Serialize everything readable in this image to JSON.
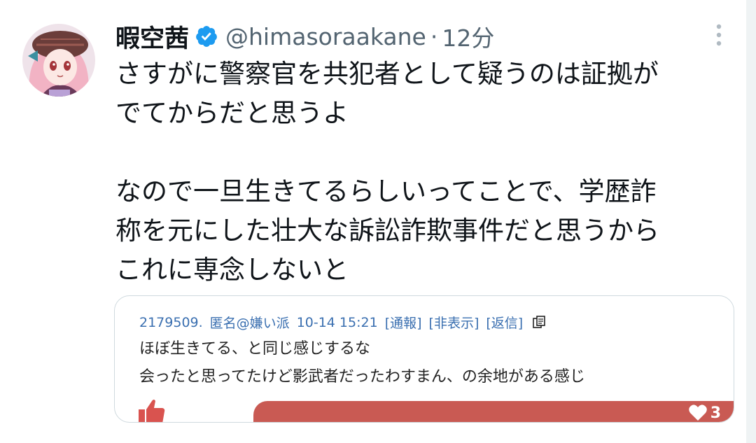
{
  "tweet": {
    "display_name": "暇空茜",
    "handle": "@himasoraakane",
    "separator": "·",
    "time": "12分",
    "text_lines": [
      "さすがに警察官を共犯者として疑うのは証拠が",
      "でてからだと思うよ",
      "",
      "なので一旦生きてるらしいってことで、学歴詐",
      "称を元にした壮大な訴訟詐欺事件だと思うから",
      "これに専念しないと"
    ]
  },
  "embed": {
    "post_number": "2179509.",
    "author": "匿名@嫌い派",
    "datetime": "10-14 15:21",
    "report_label": "[通報]",
    "hide_label": "[非表示]",
    "reply_label": "[返信]",
    "body_lines": [
      "ほぼ生きてる、と同じ感じするな",
      "会ったと思ってたけど影武者だったわすまん、の余地がある感じ"
    ],
    "like_count": "3"
  },
  "colors": {
    "accent_blue": "#1d9bf0",
    "link_blue": "#3a6fb0",
    "vote_red": "#c95a53",
    "thumb_red": "#d9534f"
  },
  "icons": {
    "verified": "verified-badge-icon",
    "more": "more-options-icon",
    "copy": "copy-icon",
    "thumb": "thumbs-up-icon",
    "heart": "heart-icon"
  }
}
